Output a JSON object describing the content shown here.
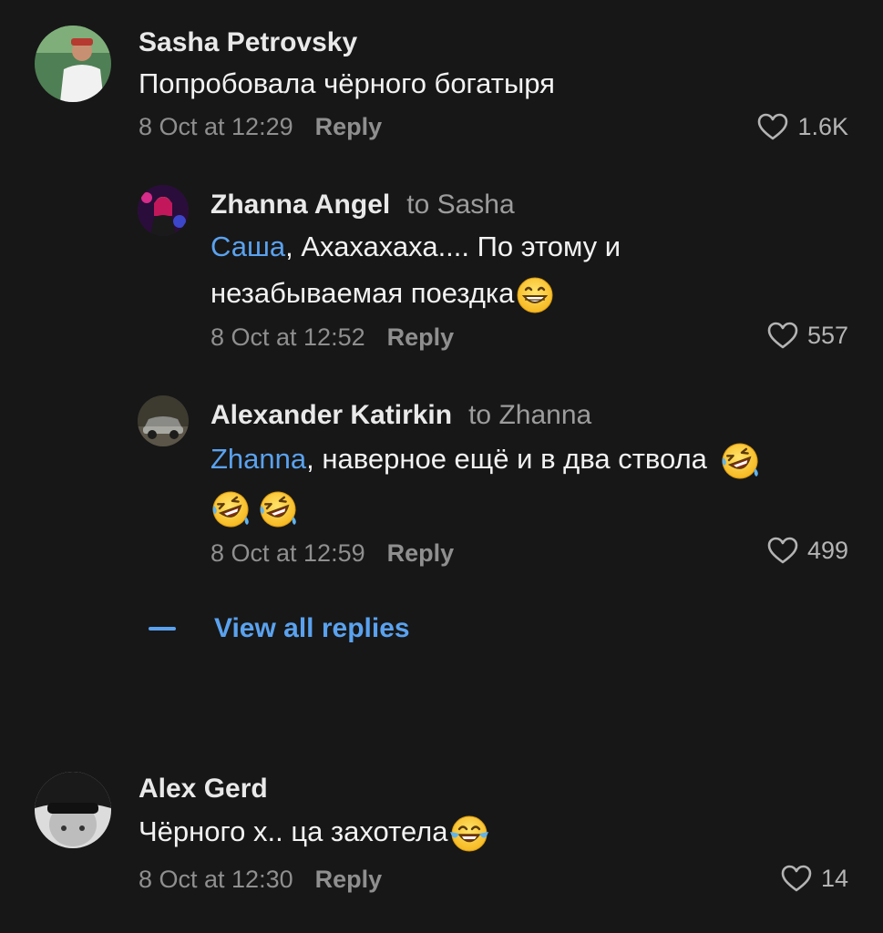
{
  "comments": [
    {
      "author": "Sasha Petrovsky",
      "to": "",
      "mention": "",
      "text": "Попробовала чёрного богатыря",
      "text2": "",
      "date": "8 Oct at 12:29",
      "reply_label": "Reply",
      "likes": "1.6K"
    },
    {
      "author": "Zhanna Angel",
      "to": "to Sasha",
      "mention": "Саша",
      "text": ", Ахахахаха.... По этому и",
      "text2": "незабываемая поездка",
      "emoji": "grinning-face",
      "date": "8 Oct at 12:52",
      "reply_label": "Reply",
      "likes": "557"
    },
    {
      "author": "Alexander Katirkin",
      "to": "to Zhanna",
      "mention": "Zhanna",
      "text": ", наверное ещё  и в два ствола",
      "emoji": "rolling-on-floor-laughing",
      "date": "8 Oct at 12:59",
      "reply_label": "Reply",
      "likes": "499"
    },
    {
      "author": "Alex Gerd",
      "to": "",
      "mention": "",
      "text": "Чёрного х.. ца захотела",
      "emoji": "face-with-tears-of-joy",
      "date": "8 Oct at 12:30",
      "reply_label": "Reply",
      "likes": "14"
    }
  ],
  "view_all_replies": "View all replies",
  "colors": {
    "background": "#171717",
    "link": "#5aa2ef",
    "muted": "#8f8f8f"
  }
}
